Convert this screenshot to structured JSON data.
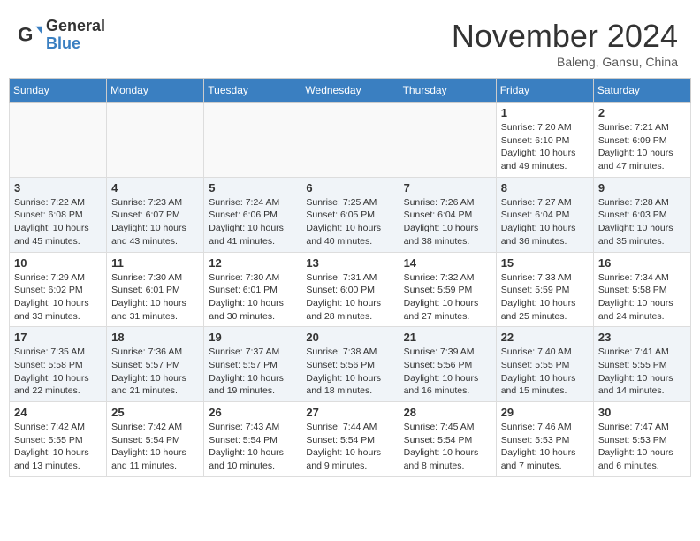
{
  "header": {
    "logo_general": "General",
    "logo_blue": "Blue",
    "month_title": "November 2024",
    "subtitle": "Baleng, Gansu, China"
  },
  "weekdays": [
    "Sunday",
    "Monday",
    "Tuesday",
    "Wednesday",
    "Thursday",
    "Friday",
    "Saturday"
  ],
  "weeks": [
    [
      {
        "day": "",
        "info": ""
      },
      {
        "day": "",
        "info": ""
      },
      {
        "day": "",
        "info": ""
      },
      {
        "day": "",
        "info": ""
      },
      {
        "day": "",
        "info": ""
      },
      {
        "day": "1",
        "info": "Sunrise: 7:20 AM\nSunset: 6:10 PM\nDaylight: 10 hours\nand 49 minutes."
      },
      {
        "day": "2",
        "info": "Sunrise: 7:21 AM\nSunset: 6:09 PM\nDaylight: 10 hours\nand 47 minutes."
      }
    ],
    [
      {
        "day": "3",
        "info": "Sunrise: 7:22 AM\nSunset: 6:08 PM\nDaylight: 10 hours\nand 45 minutes."
      },
      {
        "day": "4",
        "info": "Sunrise: 7:23 AM\nSunset: 6:07 PM\nDaylight: 10 hours\nand 43 minutes."
      },
      {
        "day": "5",
        "info": "Sunrise: 7:24 AM\nSunset: 6:06 PM\nDaylight: 10 hours\nand 41 minutes."
      },
      {
        "day": "6",
        "info": "Sunrise: 7:25 AM\nSunset: 6:05 PM\nDaylight: 10 hours\nand 40 minutes."
      },
      {
        "day": "7",
        "info": "Sunrise: 7:26 AM\nSunset: 6:04 PM\nDaylight: 10 hours\nand 38 minutes."
      },
      {
        "day": "8",
        "info": "Sunrise: 7:27 AM\nSunset: 6:04 PM\nDaylight: 10 hours\nand 36 minutes."
      },
      {
        "day": "9",
        "info": "Sunrise: 7:28 AM\nSunset: 6:03 PM\nDaylight: 10 hours\nand 35 minutes."
      }
    ],
    [
      {
        "day": "10",
        "info": "Sunrise: 7:29 AM\nSunset: 6:02 PM\nDaylight: 10 hours\nand 33 minutes."
      },
      {
        "day": "11",
        "info": "Sunrise: 7:30 AM\nSunset: 6:01 PM\nDaylight: 10 hours\nand 31 minutes."
      },
      {
        "day": "12",
        "info": "Sunrise: 7:30 AM\nSunset: 6:01 PM\nDaylight: 10 hours\nand 30 minutes."
      },
      {
        "day": "13",
        "info": "Sunrise: 7:31 AM\nSunset: 6:00 PM\nDaylight: 10 hours\nand 28 minutes."
      },
      {
        "day": "14",
        "info": "Sunrise: 7:32 AM\nSunset: 5:59 PM\nDaylight: 10 hours\nand 27 minutes."
      },
      {
        "day": "15",
        "info": "Sunrise: 7:33 AM\nSunset: 5:59 PM\nDaylight: 10 hours\nand 25 minutes."
      },
      {
        "day": "16",
        "info": "Sunrise: 7:34 AM\nSunset: 5:58 PM\nDaylight: 10 hours\nand 24 minutes."
      }
    ],
    [
      {
        "day": "17",
        "info": "Sunrise: 7:35 AM\nSunset: 5:58 PM\nDaylight: 10 hours\nand 22 minutes."
      },
      {
        "day": "18",
        "info": "Sunrise: 7:36 AM\nSunset: 5:57 PM\nDaylight: 10 hours\nand 21 minutes."
      },
      {
        "day": "19",
        "info": "Sunrise: 7:37 AM\nSunset: 5:57 PM\nDaylight: 10 hours\nand 19 minutes."
      },
      {
        "day": "20",
        "info": "Sunrise: 7:38 AM\nSunset: 5:56 PM\nDaylight: 10 hours\nand 18 minutes."
      },
      {
        "day": "21",
        "info": "Sunrise: 7:39 AM\nSunset: 5:56 PM\nDaylight: 10 hours\nand 16 minutes."
      },
      {
        "day": "22",
        "info": "Sunrise: 7:40 AM\nSunset: 5:55 PM\nDaylight: 10 hours\nand 15 minutes."
      },
      {
        "day": "23",
        "info": "Sunrise: 7:41 AM\nSunset: 5:55 PM\nDaylight: 10 hours\nand 14 minutes."
      }
    ],
    [
      {
        "day": "24",
        "info": "Sunrise: 7:42 AM\nSunset: 5:55 PM\nDaylight: 10 hours\nand 13 minutes."
      },
      {
        "day": "25",
        "info": "Sunrise: 7:42 AM\nSunset: 5:54 PM\nDaylight: 10 hours\nand 11 minutes."
      },
      {
        "day": "26",
        "info": "Sunrise: 7:43 AM\nSunset: 5:54 PM\nDaylight: 10 hours\nand 10 minutes."
      },
      {
        "day": "27",
        "info": "Sunrise: 7:44 AM\nSunset: 5:54 PM\nDaylight: 10 hours\nand 9 minutes."
      },
      {
        "day": "28",
        "info": "Sunrise: 7:45 AM\nSunset: 5:54 PM\nDaylight: 10 hours\nand 8 minutes."
      },
      {
        "day": "29",
        "info": "Sunrise: 7:46 AM\nSunset: 5:53 PM\nDaylight: 10 hours\nand 7 minutes."
      },
      {
        "day": "30",
        "info": "Sunrise: 7:47 AM\nSunset: 5:53 PM\nDaylight: 10 hours\nand 6 minutes."
      }
    ]
  ]
}
